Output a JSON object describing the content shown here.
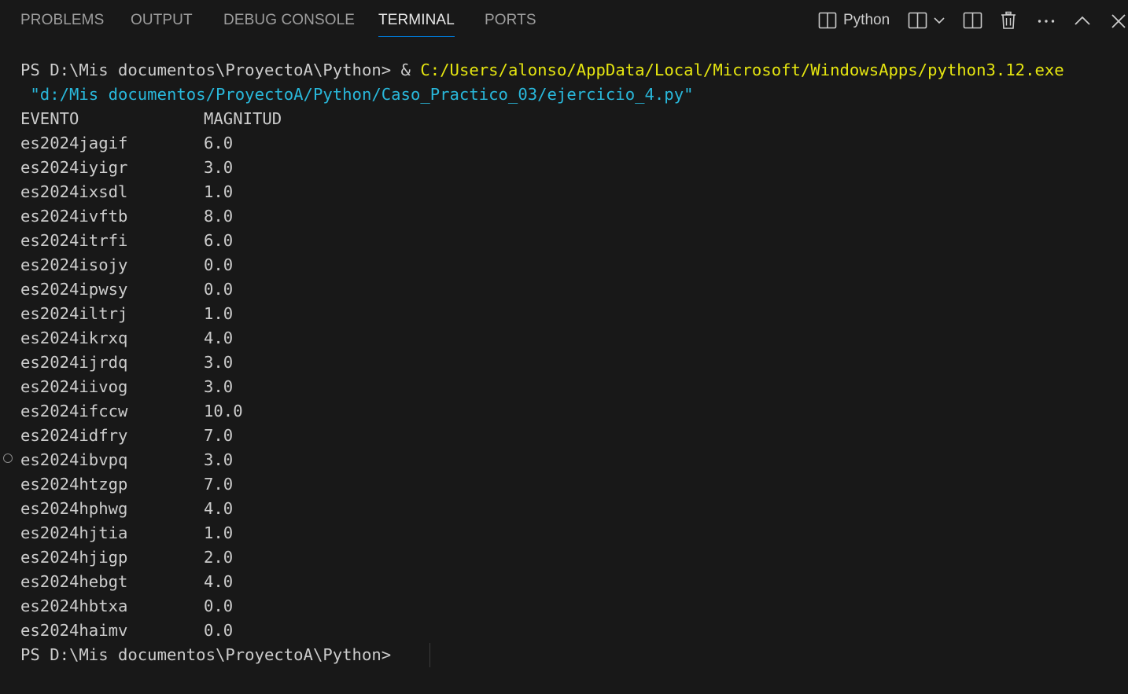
{
  "panel": {
    "tabs": [
      {
        "label": "PROBLEMS"
      },
      {
        "label": "OUTPUT"
      },
      {
        "label": "DEBUG CONSOLE"
      },
      {
        "label": "TERMINAL",
        "active": true
      },
      {
        "label": "PORTS"
      }
    ],
    "actions": {
      "terminal_name": "Python",
      "icons": [
        "terminal-icon",
        "split-terminal-icon",
        "chevron-down-icon",
        "split-editor-icon",
        "trash-icon",
        "more-icon",
        "maximize-chevron-up-icon",
        "close-icon"
      ]
    }
  },
  "terminal": {
    "command": {
      "prompt": "PS D:\\Mis documentos\\ProyectoA\\Python> ",
      "operator": "& ",
      "exe_path": "C:/Users/alonso/AppData/Local/Microsoft/WindowsApps/python3.12.exe",
      "script_path": " \"d:/Mis documentos/ProyectoA/Python/Caso_Practico_03/ejercicio_4.py\""
    },
    "table_header": {
      "col1": "EVENTO",
      "col2": "MAGNITUD"
    },
    "rows": [
      {
        "evento": "es2024jagif",
        "magnitud": "6.0"
      },
      {
        "evento": "es2024iyigr",
        "magnitud": "3.0"
      },
      {
        "evento": "es2024ixsdl",
        "magnitud": "1.0"
      },
      {
        "evento": "es2024ivftb",
        "magnitud": "8.0"
      },
      {
        "evento": "es2024itrfi",
        "magnitud": "6.0"
      },
      {
        "evento": "es2024isojy",
        "magnitud": "0.0"
      },
      {
        "evento": "es2024ipwsy",
        "magnitud": "0.0"
      },
      {
        "evento": "es2024iltrj",
        "magnitud": "1.0"
      },
      {
        "evento": "es2024ikrxq",
        "magnitud": "4.0"
      },
      {
        "evento": "es2024ijrdq",
        "magnitud": "3.0"
      },
      {
        "evento": "es2024iivog",
        "magnitud": "3.0"
      },
      {
        "evento": "es2024ifccw",
        "magnitud": "10.0"
      },
      {
        "evento": "es2024idfry",
        "magnitud": "7.0"
      },
      {
        "evento": "es2024ibvpq",
        "magnitud": "3.0"
      },
      {
        "evento": "es2024htzgp",
        "magnitud": "7.0"
      },
      {
        "evento": "es2024hphwg",
        "magnitud": "4.0"
      },
      {
        "evento": "es2024hjtia",
        "magnitud": "1.0"
      },
      {
        "evento": "es2024hjigp",
        "magnitud": "2.0"
      },
      {
        "evento": "es2024hebgt",
        "magnitud": "4.0"
      },
      {
        "evento": "es2024hbtxa",
        "magnitud": "0.0"
      },
      {
        "evento": "es2024haimv",
        "magnitud": "0.0"
      }
    ],
    "final_prompt": "PS D:\\Mis documentos\\ProyectoA\\Python>"
  },
  "colors": {
    "background": "#181818",
    "text": "#cccccc",
    "exe_path": "#e5e510",
    "script_path": "#29b8db",
    "active_tab_underline": "#0078d4"
  }
}
